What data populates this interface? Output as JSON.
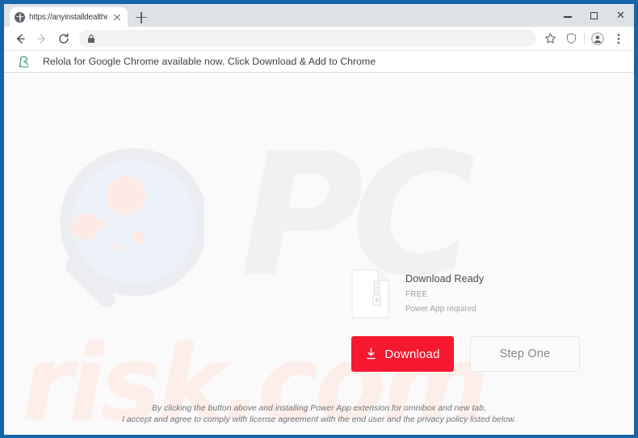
{
  "window": {
    "controls": {
      "minimize_label": "Minimize",
      "maximize_label": "Maximize",
      "close_label": "Close",
      "close_glyph": "✕"
    },
    "border_color": "#1565a8"
  },
  "tabstrip": {
    "tabs": [
      {
        "title": "https://anyinstalldealtheclicks.icu",
        "favicon": "globe-icon",
        "close_label": "Close tab",
        "active": true
      }
    ],
    "new_tab_label": "New tab"
  },
  "toolbar": {
    "back_label": "Back",
    "forward_label": "Forward",
    "reload_label": "Reload",
    "omnibox": {
      "value": "",
      "placeholder": "",
      "security_icon": "lock-icon"
    },
    "bookmark_label": "Bookmark this tab",
    "shield_label": "Site protection",
    "profile_label": "Profile",
    "menu_label": "Customize and control Google Chrome"
  },
  "banner": {
    "logo": "relola-r-logo",
    "logo_color": "#4aa181",
    "text": "Relola for Google Chrome  available now. Click Download & Add to Chrome"
  },
  "page": {
    "background": "#fafafa",
    "watermarks": {
      "pc": "PC",
      "risk": "risk.com",
      "pc_color": "#f1f1f1",
      "risk_color": "#fdeeea",
      "glass_icon": "magnifying-glass-watermark"
    },
    "product": {
      "file_icon": "zip-file-icon",
      "title": "Download Ready",
      "price": "FREE",
      "requirement": "Power App required"
    },
    "actions": {
      "download_label": "Download",
      "download_icon": "download-arrow-icon",
      "download_color": "#f5182f",
      "step_one_label": "Step One"
    },
    "disclaimer": {
      "line1": "By clicking the button above and installing  Power App  extension for omnibox and new tab,",
      "line2": "I accept and agree to comply with license agreement with the end user and the privacy policy listed below."
    }
  }
}
